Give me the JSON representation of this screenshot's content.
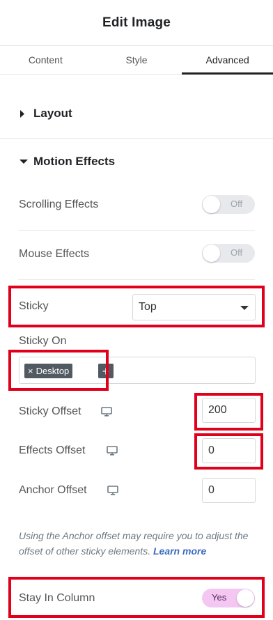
{
  "header": {
    "title": "Edit Image"
  },
  "tabs": [
    {
      "label": "Content"
    },
    {
      "label": "Style"
    },
    {
      "label": "Advanced"
    }
  ],
  "sections": {
    "layout": {
      "label": "Layout"
    },
    "motion": {
      "label": "Motion Effects"
    }
  },
  "scrolling_effects": {
    "label": "Scrolling Effects",
    "toggle": "Off"
  },
  "mouse_effects": {
    "label": "Mouse Effects",
    "toggle": "Off"
  },
  "sticky": {
    "label": "Sticky",
    "value": "Top"
  },
  "sticky_on": {
    "label": "Sticky On",
    "tag": "Desktop",
    "tag_remove": "×",
    "add": "+"
  },
  "sticky_offset": {
    "label": "Sticky Offset",
    "value": "200",
    "device_icon": "desktop-icon"
  },
  "effects_offset": {
    "label": "Effects Offset",
    "value": "0",
    "device_icon": "desktop-icon"
  },
  "anchor_offset": {
    "label": "Anchor Offset",
    "value": "0",
    "device_icon": "desktop-icon"
  },
  "note": {
    "text": "Using the Anchor offset may require you to adjust the offset of other sticky elements.",
    "link": "Learn more"
  },
  "stay_in_column": {
    "label": "Stay In Column",
    "toggle": "Yes"
  },
  "colors": {
    "highlight": "#e0001b",
    "toggle_on": "#f3c7f2"
  }
}
